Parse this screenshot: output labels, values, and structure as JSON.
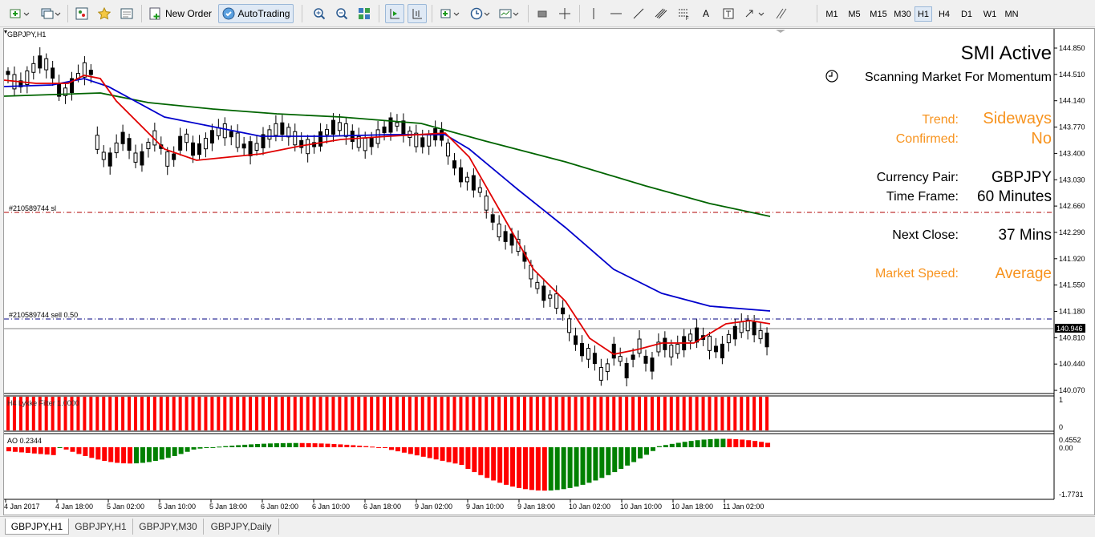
{
  "toolbar": {
    "new_order_label": "New Order",
    "autotrading_label": "AutoTrading",
    "timeframes": [
      "M1",
      "M5",
      "M15",
      "M30",
      "H1",
      "H4",
      "D1",
      "W1",
      "MN"
    ],
    "active_timeframe": "H1",
    "text_tool_label": "A"
  },
  "chart": {
    "symbol_title": "GBPJPY,H1",
    "sl_line_label": "#210589744 sl",
    "order_line_label": "#210589744 sell 0.50",
    "price_ticks": [
      "144.850",
      "144.510",
      "144.140",
      "143.770",
      "143.400",
      "143.030",
      "142.660",
      "142.290",
      "141.920",
      "141.550",
      "141.180",
      "140.810",
      "140.440",
      "140.070"
    ],
    "current_price": "140.946",
    "time_labels": [
      "4 Jan 2017",
      "4 Jan 18:00",
      "5 Jan 02:00",
      "5 Jan 10:00",
      "5 Jan 18:00",
      "6 Jan 02:00",
      "6 Jan 10:00",
      "6 Jan 18:00",
      "9 Jan 02:00",
      "9 Jan 10:00",
      "9 Jan 18:00",
      "10 Jan 02:00",
      "10 Jan 10:00",
      "10 Jan 18:00",
      "11 Jan 02:00"
    ],
    "indicator1_label": "H4 Lykke Filter 1.0000",
    "indicator1_scale_top": "1",
    "indicator1_scale_bottom": "0",
    "ao_label": "AO 0.2344",
    "ao_scale_top": "0.4552",
    "ao_scale_zero": "0.00",
    "ao_scale_bottom": "-1.7731",
    "colors": {
      "fast_ma": "#e00000",
      "mid_ma": "#0000cc",
      "slow_ma": "#006400",
      "ao_up": "#008000",
      "ao_down": "#ff0000",
      "filter_bars": "#ff0000",
      "panel_accent": "#f7931e"
    }
  },
  "smi_panel": {
    "title": "SMI Active",
    "scanning_text": "Scanning Market For Momentum",
    "clock_icon": "clock-icon",
    "trend_label": "Trend:",
    "trend_value": "Sideways",
    "confirmed_label": "Confirmed:",
    "confirmed_value": "No",
    "pair_label": "Currency Pair:",
    "pair_value": "GBPJPY",
    "timeframe_label": "Time Frame:",
    "timeframe_value": "60 Minutes",
    "next_close_label": "Next Close:",
    "next_close_value": "37 Mins",
    "market_speed_label": "Market Speed:",
    "market_speed_value": "Average"
  },
  "tabs": [
    "GBPJPY,H1",
    "GBPJPY,H1",
    "GBPJPY,M30",
    "GBPJPY,Daily"
  ],
  "active_tab_index": 0
}
